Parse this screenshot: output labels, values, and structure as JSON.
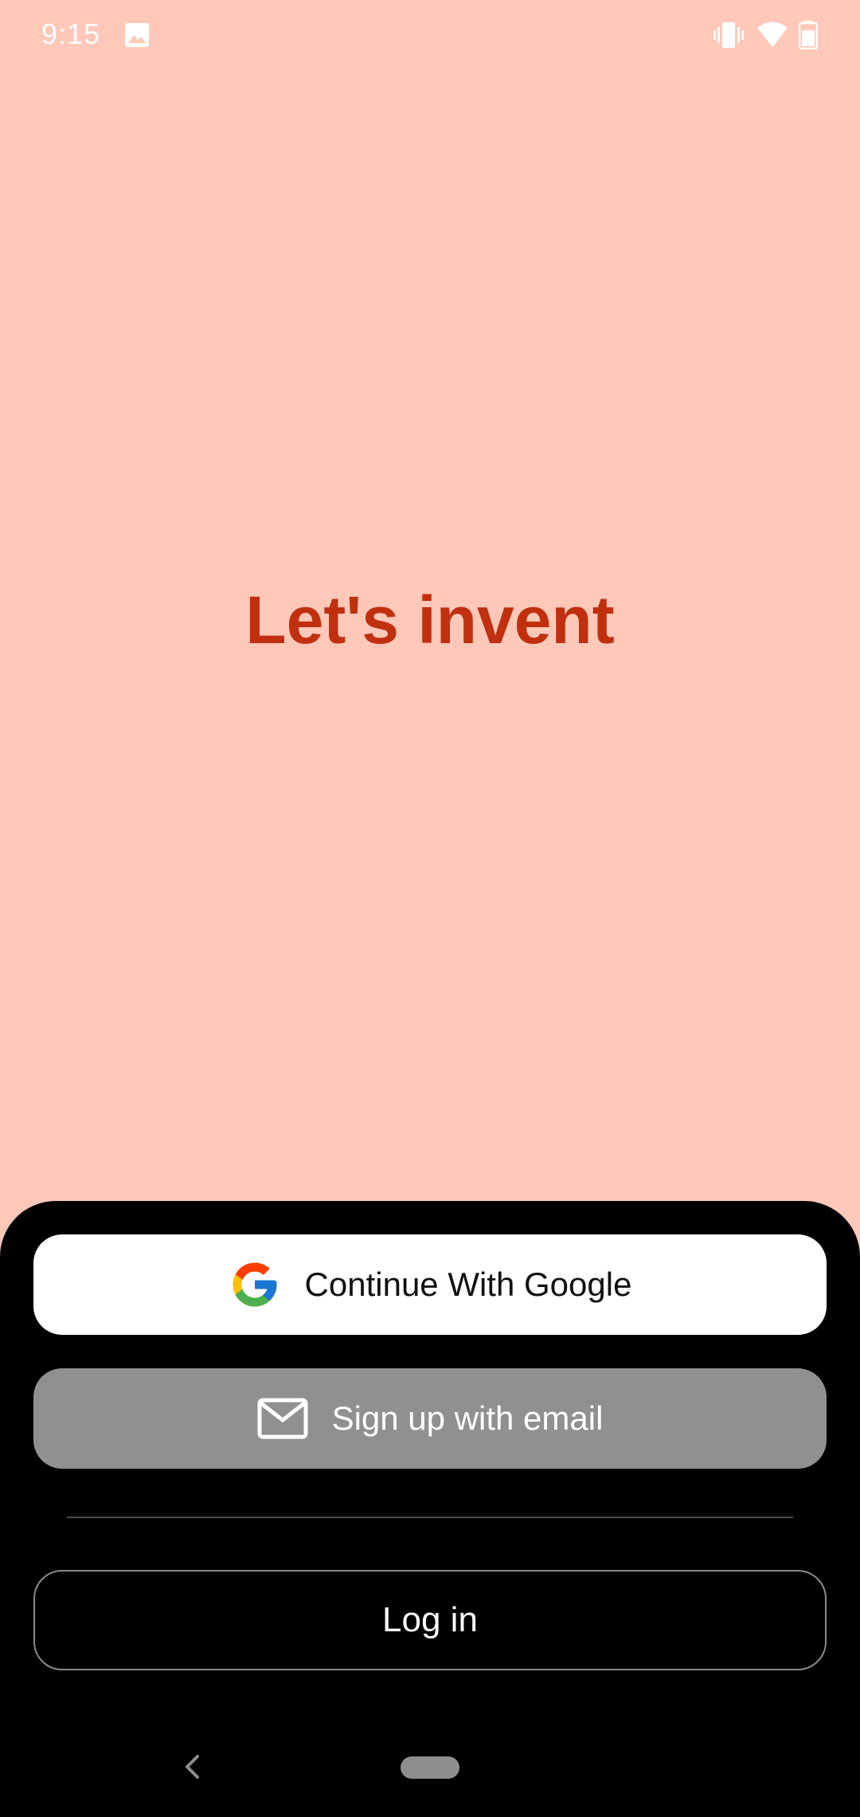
{
  "status_bar": {
    "time": "9:15",
    "icons": [
      "gallery-icon",
      "vibrate-icon",
      "wifi-icon",
      "battery-icon"
    ]
  },
  "headline": "Let's invent",
  "auth": {
    "google_label": "Continue With Google",
    "email_label": "Sign up with email",
    "login_label": "Log in"
  },
  "colors": {
    "background": "#FFC8B8",
    "headline": "#C0300F",
    "sheet": "#000000",
    "google_button": "#FFFFFF",
    "email_button": "#909090"
  }
}
